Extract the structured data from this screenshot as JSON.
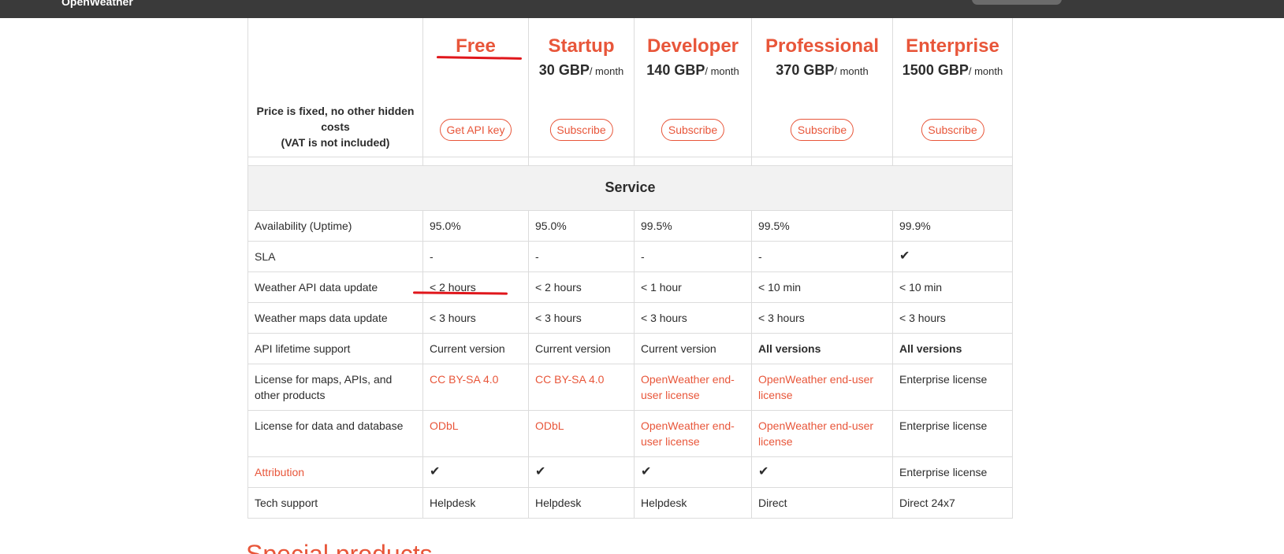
{
  "header": {
    "logo_text": "OpenWeather"
  },
  "plans": [
    {
      "name": "Free",
      "price": "",
      "per": "",
      "button": "Get API key"
    },
    {
      "name": "Startup",
      "price": "30 GBP",
      "per": "/ month",
      "button": "Subscribe"
    },
    {
      "name": "Developer",
      "price": "140 GBP",
      "per": "/ month",
      "button": "Subscribe"
    },
    {
      "name": "Professional",
      "price": "370 GBP",
      "per": "/ month",
      "button": "Subscribe"
    },
    {
      "name": "Enterprise",
      "price": "1500 GBP",
      "per": "/ month",
      "button": "Subscribe"
    }
  ],
  "price_note": {
    "line1": "Price is fixed, no other hidden costs",
    "line2": "(VAT is not included)"
  },
  "section_title": "Service",
  "rows": [
    {
      "label": "Availability (Uptime)",
      "cells": [
        "95.0%",
        "95.0%",
        "99.5%",
        "99.5%",
        "99.9%"
      ]
    },
    {
      "label": "SLA",
      "cells": [
        "-",
        "-",
        "-",
        "-",
        "✔"
      ]
    },
    {
      "label": "Weather API data update",
      "cells": [
        "< 2 hours",
        "< 2 hours",
        "< 1 hour",
        "< 10 min",
        "< 10 min"
      ]
    },
    {
      "label": "Weather maps data update",
      "cells": [
        "< 3 hours",
        "< 3 hours",
        "< 3 hours",
        "< 3 hours",
        "< 3 hours"
      ]
    },
    {
      "label": "API lifetime support",
      "cells": [
        "Current version",
        "Current version",
        "Current version",
        "All versions",
        "All versions"
      ]
    },
    {
      "label": "License for maps, APIs, and other products",
      "cells": [
        "CC BY-SA 4.0",
        "CC BY-SA 4.0",
        "OpenWeather end-user license",
        "OpenWeather end-user license",
        "Enterprise license"
      ]
    },
    {
      "label": "License for data and database",
      "cells": [
        "ODbL",
        "ODbL",
        "OpenWeather end-user license",
        "OpenWeather end-user license",
        "Enterprise license"
      ]
    },
    {
      "label": "Attribution",
      "cells": [
        "✔",
        "✔",
        "✔",
        "✔",
        "Enterprise license"
      ]
    },
    {
      "label": "Tech support",
      "cells": [
        "Helpdesk",
        "Helpdesk",
        "Helpdesk",
        "Direct",
        "Direct 24x7"
      ]
    }
  ],
  "special_products_heading": "Special products",
  "colors": {
    "accent": "#e8563a",
    "annotation": "#e0161b",
    "topbar": "#3a3a3a"
  }
}
